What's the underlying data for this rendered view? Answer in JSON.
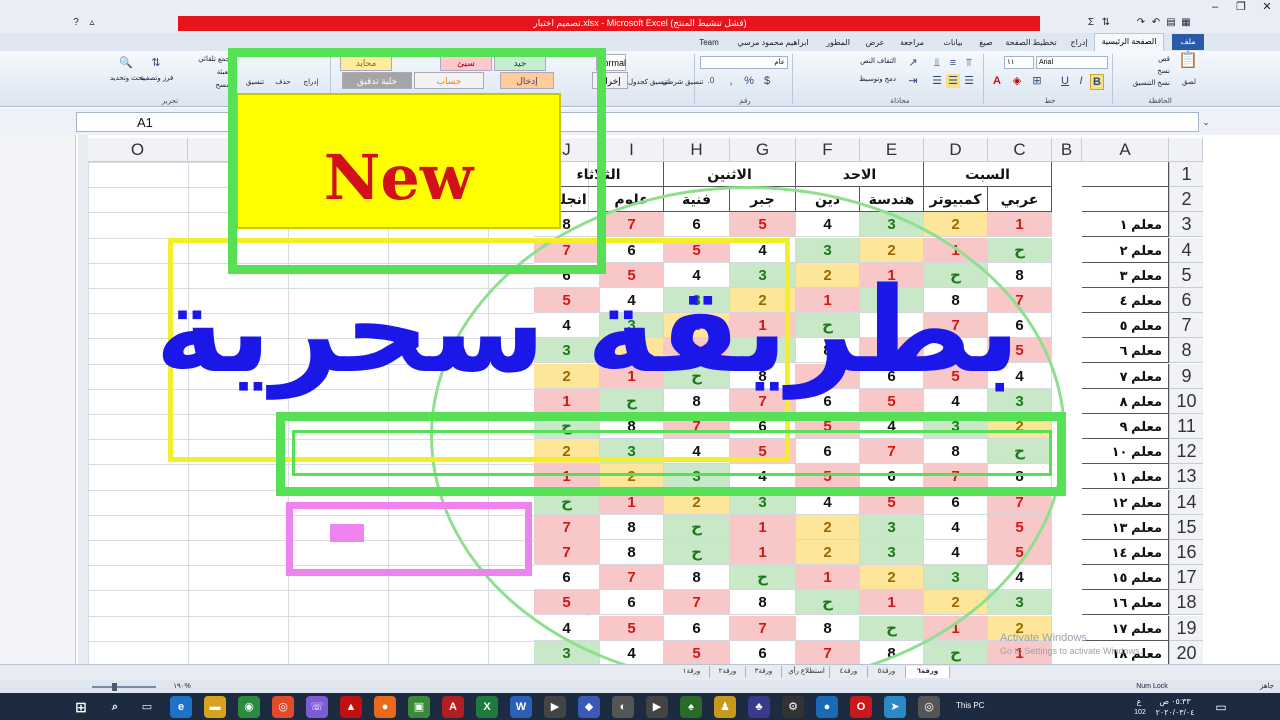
{
  "window": {
    "title": "تصميم اختبار.xlsx - Microsoft Excel (فشل تنشيط المنتج)"
  },
  "ribbon": {
    "tabs": [
      "ملف",
      "الصفحة الرئيسية",
      "إدراج",
      "تخطيط الصفحة",
      "صيغ",
      "بيانات",
      "مراجعة",
      "عرض",
      "المطور",
      "ابراهيم محمود مرسي",
      "Team"
    ],
    "font_name": "Arial",
    "font_size": "١١",
    "number_format": "عام",
    "clipboard": {
      "cut": "قص",
      "copy": "نسخ",
      "format_painter": "نسخ التنسيق",
      "paste": "لصق",
      "label": "الحافظة"
    },
    "group_labels": {
      "font": "خط",
      "alignment": "محاذاة",
      "number": "رقم",
      "editing": "تحرير"
    },
    "alignment": {
      "wrap": "التفاف النص",
      "merge": "دمج وتوسيط"
    },
    "styles": {
      "conditional": "تنسيق شرطي",
      "as_table": "تنسيق كجدول",
      "normal": "Normal",
      "bad": "سيئ",
      "good": "جيد",
      "neutral": "محايد",
      "output": "إخراج",
      "input": "إدخال",
      "calc": "حساب",
      "check": "خلية تدقيق"
    },
    "cells": {
      "insert": "إدراج",
      "delete": "حذف",
      "format": "تنسيق"
    },
    "editing": {
      "autosum": "جمع تلقائي",
      "fill": "تعبئة",
      "clear": "مسح",
      "sort": "فرز وتصفية",
      "find": "بحث وتحديد"
    }
  },
  "formula_bar": {
    "name_box": "A1",
    "formula": ""
  },
  "sheet": {
    "columns": [
      "A",
      "B",
      "C",
      "D",
      "E",
      "F",
      "G",
      "H",
      "I",
      "J",
      "N",
      "O"
    ],
    "rows": [
      "1",
      "2",
      "3",
      "4",
      "5",
      "6",
      "7",
      "8",
      "9",
      "10",
      "11",
      "12",
      "13",
      "14",
      "15",
      "16",
      "17",
      "18",
      "19",
      "20"
    ],
    "day_headers": [
      "السبت",
      "الاحد",
      "الاثنين",
      "الثلاثاء"
    ],
    "subject_headers": [
      "عربي",
      "كمبيوتر",
      "هندسة",
      "دين",
      "جبر",
      "فنية",
      "علوم",
      "انجليز"
    ],
    "teachers": [
      "معلم ١",
      "معلم ٢",
      "معلم ٣",
      "معلم ٤",
      "معلم ٥",
      "معلم ٦",
      "معلم ٧",
      "معلم ٨",
      "معلم ٩",
      "معلم ١٠",
      "معلم ١١",
      "معلم ١٢",
      "معلم ١٣",
      "معلم ١٤",
      "معلم ١٥",
      "معلم ١٦",
      "معلم ١٧",
      "معلم ١٨"
    ],
    "values": [
      [
        "1",
        "2",
        "3",
        "4",
        "5",
        "6",
        "7",
        "8"
      ],
      [
        "ح",
        "1",
        "2",
        "3",
        "4",
        "5",
        "6",
        "7"
      ],
      [
        "8",
        "ح",
        "1",
        "2",
        "3",
        "4",
        "5",
        "6"
      ],
      [
        "7",
        "8",
        "ح",
        "1",
        "2",
        "3",
        "4",
        "5"
      ],
      [
        "6",
        "7",
        "8",
        "ح",
        "1",
        "2",
        "3",
        "4"
      ],
      [
        "5",
        "6",
        "7",
        "8",
        "ح",
        "1",
        "2",
        "3"
      ],
      [
        "4",
        "5",
        "6",
        "7",
        "8",
        "ح",
        "1",
        "2"
      ],
      [
        "3",
        "4",
        "5",
        "6",
        "7",
        "8",
        "ح",
        "1"
      ],
      [
        "2",
        "3",
        "4",
        "5",
        "6",
        "7",
        "8",
        "ح"
      ],
      [
        "ح",
        "8",
        "7",
        "6",
        "5",
        "4",
        "3",
        "2"
      ],
      [
        "8",
        "7",
        "6",
        "5",
        "4",
        "3",
        "2",
        "1"
      ],
      [
        "7",
        "6",
        "5",
        "4",
        "3",
        "2",
        "1",
        "ح"
      ],
      [
        "5",
        "4",
        "3",
        "2",
        "1",
        "ح",
        "8",
        "7"
      ],
      [
        "5",
        "4",
        "3",
        "2",
        "1",
        "ح",
        "8",
        "7"
      ],
      [
        "4",
        "3",
        "2",
        "1",
        "ح",
        "8",
        "7",
        "6"
      ],
      [
        "3",
        "2",
        "1",
        "ح",
        "8",
        "7",
        "6",
        "5"
      ],
      [
        "2",
        "1",
        "ح",
        "8",
        "7",
        "6",
        "5",
        "4"
      ],
      [
        "1",
        "ح",
        "8",
        "7",
        "6",
        "5",
        "4",
        "3"
      ]
    ],
    "value_colors": {
      "1": "#f8c8c8",
      "2": "#fde59a",
      "3": "#c8e8c8",
      "4": "#ffffff",
      "5": "#f8c8c8",
      "6": "#ffffff",
      "7": "#f8c8c8",
      "8": "#ffffff",
      "ح": "#c8e8c8"
    },
    "text_colors": {
      "1": "#d01818",
      "2": "#9a6a00",
      "3": "#1a7a1a",
      "4": "#111111",
      "5": "#d01818",
      "6": "#111111",
      "7": "#d01818",
      "8": "#111111",
      "ح": "#1a7a1a"
    },
    "sheet_tabs": [
      "ورقة٦",
      "ورقة٥",
      "ورقة٤",
      "استطلاع رأي",
      "ورقة٣",
      "ورقة٢",
      "ورقة١"
    ]
  },
  "overlays": {
    "new_label": "New",
    "title_label": "بطريقة سحرية"
  },
  "status": {
    "ready": "جاهز",
    "num_lock": "Num Lock",
    "zoom": "١٩٠%"
  },
  "watermark": {
    "line1": "Activate Windows",
    "line2": "Go to Settings to activate Windows."
  },
  "taskbar": {
    "this_pc": "This PC",
    "time": "٠٥:٣٣ ص",
    "date": "٢٠٢٠/٠٣/٠٤",
    "num": "102",
    "lang": "ع"
  }
}
